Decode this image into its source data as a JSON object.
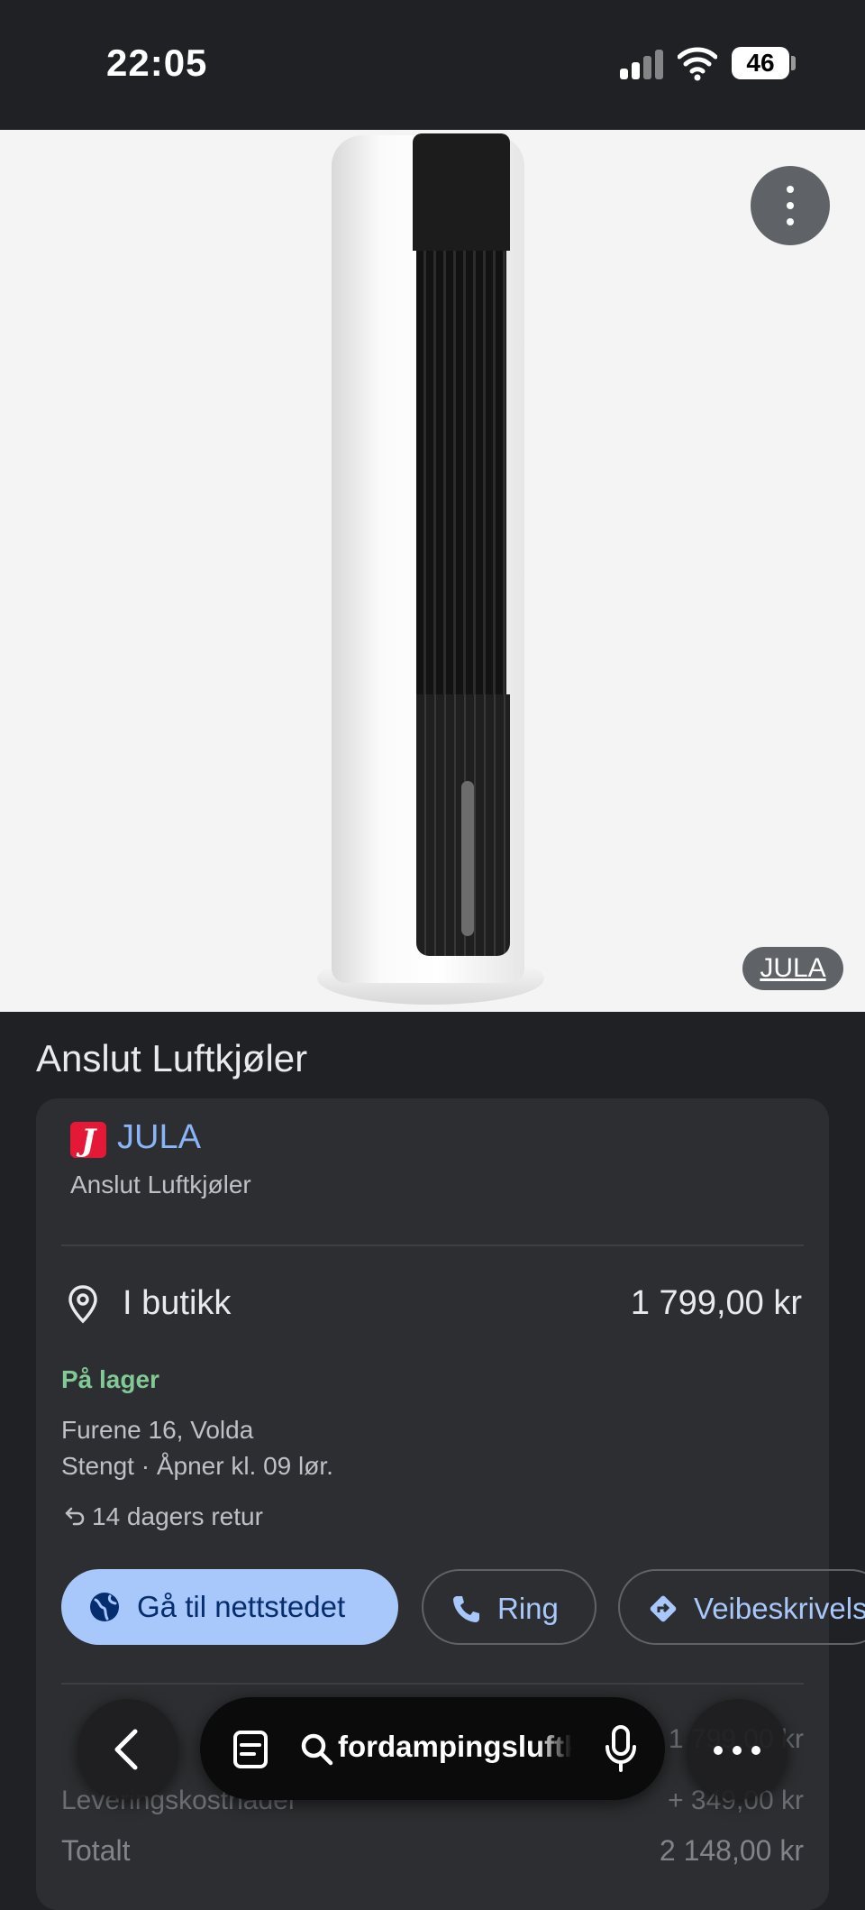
{
  "status_bar": {
    "time": "22:05",
    "battery": "46"
  },
  "hero": {
    "source_badge": "JULA"
  },
  "product": {
    "title": "Anslut Luftkjøler"
  },
  "offer": {
    "store_logo_letter": "J",
    "store_name": "JULA",
    "product_name": "Anslut Luftkjøler",
    "channel": "I butikk",
    "price": "1 799,00 kr",
    "stock": "På lager",
    "address": "Furene 16, Volda",
    "hours": "Stengt · Åpner kl. 09 lør.",
    "return_policy": "14 dagers retur",
    "accent_color": "#a8c7fa",
    "stock_color": "#81c995"
  },
  "actions": {
    "website": "Gå til nettstedet",
    "call": "Ring",
    "directions": "Veibeskrivelse"
  },
  "obscured_rows": {
    "row1_right": "1 799,00 kr",
    "delivery_label": "Leveringskostnader",
    "delivery_value": "+ 349,00 kr",
    "total_label": "Totalt",
    "total_value": "2 148,00 kr"
  },
  "toolbar": {
    "search_query": "fordampingsluftkjøler"
  }
}
